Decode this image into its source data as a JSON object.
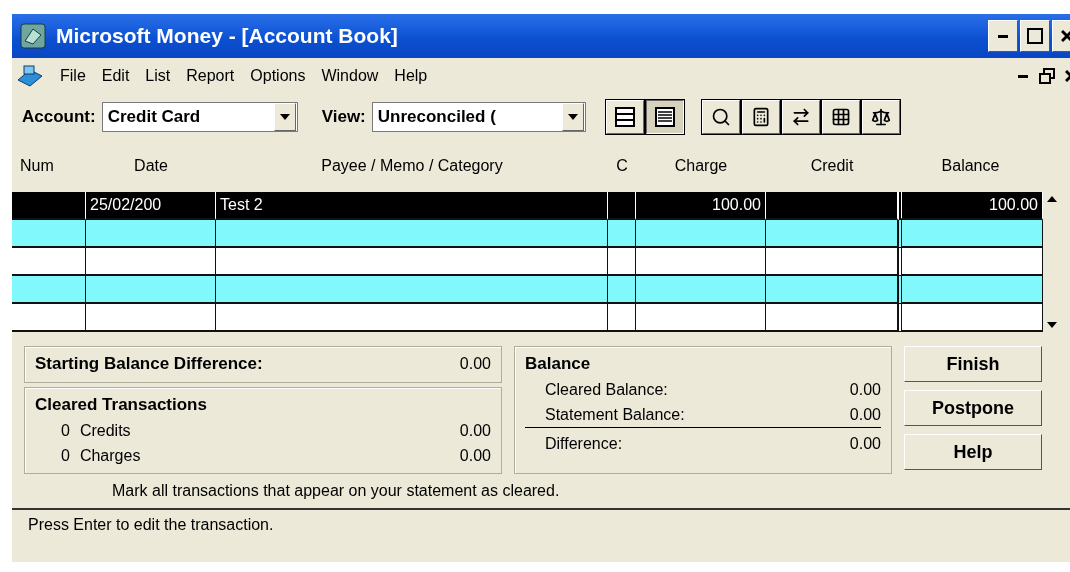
{
  "window": {
    "title": "Microsoft Money - [Account Book]"
  },
  "menu": [
    {
      "label": "File"
    },
    {
      "label": "Edit"
    },
    {
      "label": "List"
    },
    {
      "label": "Report"
    },
    {
      "label": "Options"
    },
    {
      "label": "Window"
    },
    {
      "label": "Help"
    }
  ],
  "toolbar": {
    "account": {
      "label": "Account:",
      "value": "Credit Card"
    },
    "view": {
      "label": "View:",
      "value": "Unreconciled ("
    },
    "view_buttons": [
      {
        "kind": "split",
        "pressed": false
      },
      {
        "kind": "full",
        "pressed": true
      }
    ],
    "tools": [
      {
        "kind": "search"
      },
      {
        "kind": "calculator"
      },
      {
        "kind": "transfer"
      },
      {
        "kind": "grid"
      },
      {
        "kind": "scale"
      }
    ]
  },
  "table": {
    "columns": [
      "Num",
      "Date",
      "Payee / Memo / Category",
      "C",
      "Charge",
      "Credit",
      "Balance"
    ],
    "rows": [
      {
        "selected": true,
        "date": "25/02/200",
        "payee": "Test 2",
        "charge": "100.00",
        "balance": "100.00"
      },
      {
        "selected": false
      },
      {
        "selected": false
      },
      {
        "selected": false
      },
      {
        "selected": false
      }
    ]
  },
  "summary": {
    "starting_label": "Starting Balance Difference:",
    "starting_value": "0.00",
    "cleared_title": "Cleared Transactions",
    "cleared": [
      {
        "count": "0",
        "label": "Credits",
        "value": "0.00"
      },
      {
        "count": "0",
        "label": "Charges",
        "value": "0.00"
      }
    ],
    "balance_title": "Balance",
    "balance": [
      {
        "label": "Cleared Balance:",
        "value": "0.00",
        "rule_below": false
      },
      {
        "label": "Statement Balance:",
        "value": "0.00",
        "rule_below": true
      },
      {
        "label": "Difference:",
        "value": "0.00",
        "rule_below": false
      }
    ],
    "hint": "Mark all transactions that appear on your statement as cleared."
  },
  "buttons": [
    {
      "label": "Finish"
    },
    {
      "label": "Postpone"
    },
    {
      "label": "Help"
    }
  ],
  "status_bar": "Press Enter to edit the transaction."
}
